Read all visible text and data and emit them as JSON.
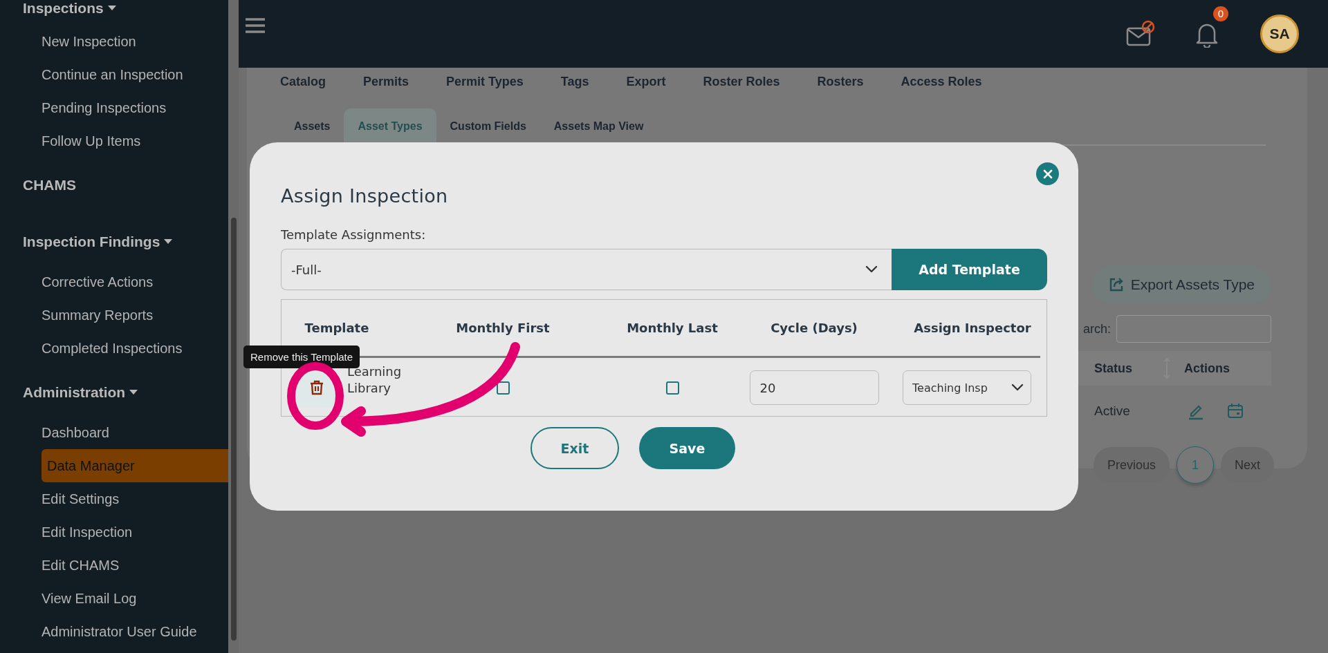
{
  "sidebar": {
    "sections": [
      {
        "label": "Inspections",
        "dropdown": true,
        "children": [
          {
            "label": "New Inspection",
            "selected": false
          },
          {
            "label": "Continue an Inspection",
            "selected": false
          },
          {
            "label": "Pending Inspections",
            "selected": false
          },
          {
            "label": "Follow Up Items",
            "selected": false
          }
        ]
      },
      {
        "label": "CHAMS",
        "dropdown": false
      },
      {
        "label": "Inspection Findings",
        "dropdown": true,
        "children": [
          {
            "label": "Corrective Actions",
            "selected": false
          },
          {
            "label": "Summary Reports",
            "selected": false
          },
          {
            "label": "Completed Inspections",
            "selected": false
          }
        ]
      },
      {
        "label": "Administration",
        "dropdown": true,
        "children": [
          {
            "label": "Dashboard",
            "selected": false
          },
          {
            "label": "Data Manager",
            "selected": true
          },
          {
            "label": "Edit Settings",
            "selected": false
          },
          {
            "label": "Edit Inspection",
            "selected": false
          },
          {
            "label": "Edit CHAMS",
            "selected": false
          },
          {
            "label": "View Email Log",
            "selected": false
          },
          {
            "label": "Administrator User Guide",
            "selected": false
          }
        ]
      }
    ]
  },
  "header": {
    "notification_count": "0",
    "avatar": "SA"
  },
  "page": {
    "top_tabs": [
      "Catalog",
      "Permits",
      "Permit Types",
      "Tags",
      "Export",
      "Roster Roles",
      "Rosters",
      "Access Roles"
    ],
    "sub_tabs": [
      {
        "label": "Assets",
        "selected": false
      },
      {
        "label": "Asset Types",
        "selected": true
      },
      {
        "label": "Custom Fields",
        "selected": false
      },
      {
        "label": "Assets Map View",
        "selected": false
      }
    ],
    "export_button": "Export Assets Type",
    "search_label": "arch:",
    "table": {
      "columns": [
        "Status",
        "Actions"
      ],
      "rows": [
        {
          "status": "Active"
        }
      ]
    },
    "pagination": {
      "previous": "Previous",
      "pages": [
        {
          "label": "1",
          "selected": true
        }
      ],
      "next": "Next"
    }
  },
  "modal": {
    "title": "Assign Inspection",
    "template_label": "Template Assignments:",
    "template_select": "-Full-",
    "add_button": "Add Template",
    "columns": [
      "Template",
      "Monthly First",
      "Monthly Last",
      "Cycle (Days)",
      "Assign Inspector"
    ],
    "rows": [
      {
        "template": "Learning Library",
        "monthly_first": false,
        "monthly_last": false,
        "cycle": "20",
        "inspector": "Teaching Insp"
      }
    ],
    "tooltip": "Remove this Template",
    "exit_button": "Exit",
    "save_button": "Save"
  }
}
